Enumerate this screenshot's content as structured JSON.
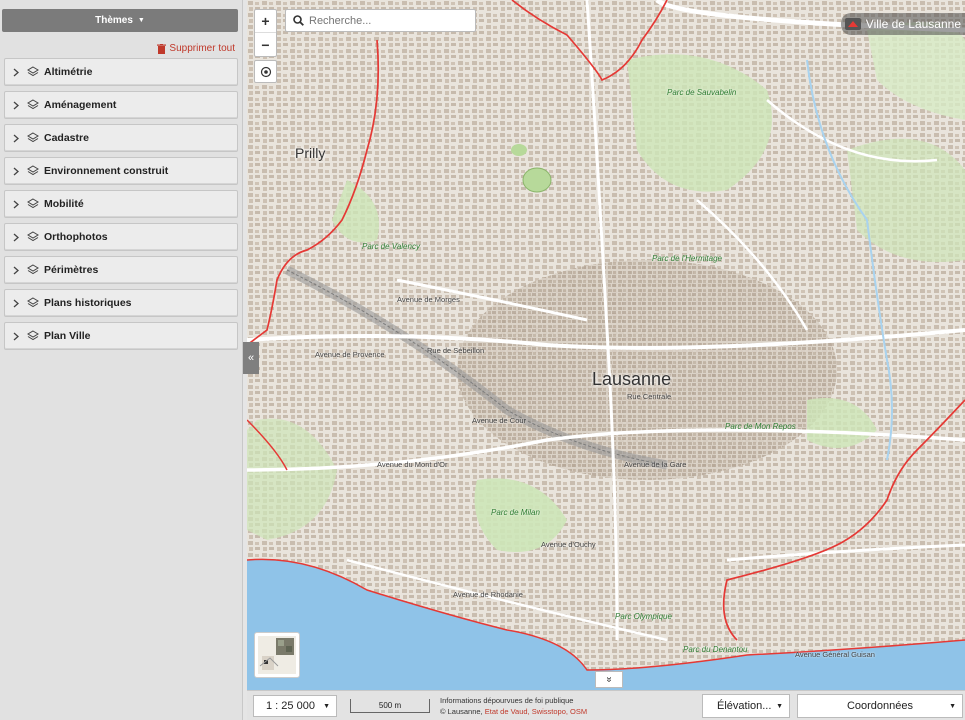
{
  "sidebar": {
    "themes_button": "Thèmes",
    "delete_all": "Supprimer tout",
    "items": [
      {
        "label": "Altimétrie"
      },
      {
        "label": "Aménagement"
      },
      {
        "label": "Cadastre"
      },
      {
        "label": "Environnement construit"
      },
      {
        "label": "Mobilité"
      },
      {
        "label": "Orthophotos"
      },
      {
        "label": "Périmètres"
      },
      {
        "label": "Plans historiques"
      },
      {
        "label": "Plan Ville"
      }
    ],
    "collapse_glyph": "«"
  },
  "map": {
    "search_placeholder": "Recherche...",
    "zoom_in": "+",
    "zoom_out": "−",
    "city_badge": "Ville de Lausanne",
    "bottom_toggle_glyph": "»",
    "labels": {
      "lausanne": "Lausanne",
      "prilly": "Prilly",
      "parc_sauvabelin": "Parc de Sauvabelin",
      "parc_valency": "Parc de Valency",
      "parc_hermitage": "Parc de l'Hermitage",
      "parc_mon_repos": "Parc de Mon Repos",
      "parc_milan": "Parc de Milan",
      "parc_olympique": "Parc Olympique",
      "parc_denantou": "Parc du Denantou",
      "av_morges": "Avenue de Morges",
      "rue_sebeillon": "Rue de Sébeillon",
      "av_provence": "Avenue de Provence",
      "av_cour": "Avenue de Cour",
      "av_gare": "Avenue de la Gare",
      "av_rhodanie": "Avenue de Rhodanie",
      "av_mon_loisir": "Avenue du Mont d'Or",
      "av_ouchy": "Avenue d'Ouchy",
      "rue_centrale": "Rue Centrale",
      "av_general_guisan": "Avenue Général Guisan"
    }
  },
  "footer": {
    "scale_value": "1 : 25 000",
    "scale_bar_label": "500 m",
    "attribution_line1": "Informations dépourvues de foi publique",
    "attribution_prefix": "© Lausanne, ",
    "attribution_sources": "Etat de Vaud, Swisstopo, OSM",
    "elevation_label": "Élévation...",
    "coords_label": "Coordonnées"
  },
  "colors": {
    "sidebar_bg": "#e1e1e1",
    "themes_button_bg": "#7b7b7b",
    "boundary_red": "#e53935",
    "lake_blue": "#8fc3e8",
    "park_green": "#cde6b8",
    "building": "#cbbfb1"
  }
}
